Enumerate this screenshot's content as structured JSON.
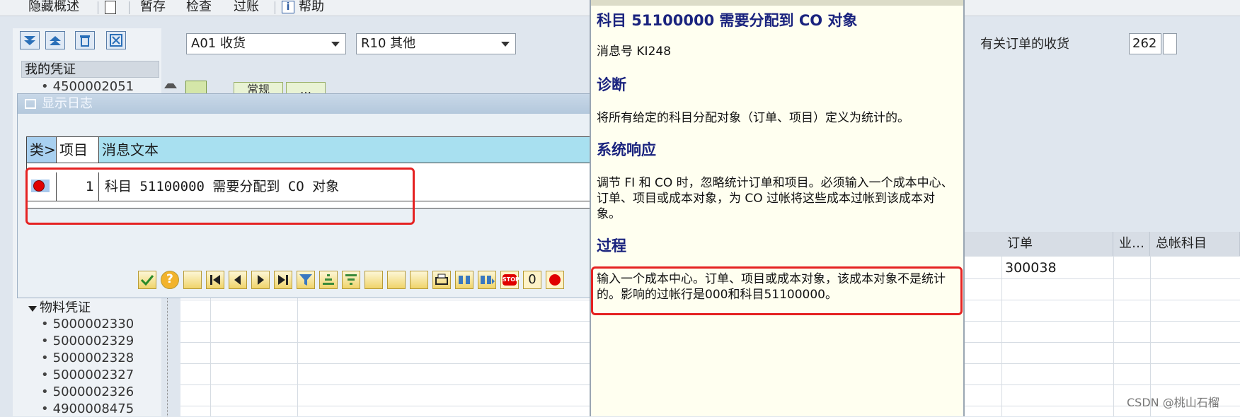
{
  "menubar": {
    "items": [
      "隐藏概述",
      "暂存",
      "检查",
      "过账",
      "帮助"
    ]
  },
  "header": {
    "action_value": "A01 收货",
    "ref_value": "R10 其他",
    "order_receipt_label": "有关订单的收货",
    "receipt_number": "262"
  },
  "tabs": [
    "常规",
    "…"
  ],
  "nav": {
    "mydoc_title": "我的凭证",
    "top_number": "4500002051",
    "matdoc_title": "物料凭证",
    "numbers": [
      "5000002330",
      "5000002329",
      "5000002328",
      "5000002327",
      "5000002326",
      "4900008475"
    ]
  },
  "log_dialog": {
    "title": "显示日志",
    "columns": [
      "类>",
      "项目",
      "消息文本"
    ],
    "rows": [
      {
        "item": "1",
        "text": "科目 51100000 需要分配到 CO 对象"
      }
    ],
    "stop_count": "0"
  },
  "grid": {
    "columns": [
      "订单",
      "业…",
      "总帐科目"
    ],
    "order_value": "300038"
  },
  "help": {
    "title": "科目 51100000 需要分配到 CO 对象",
    "msg_no": "消息号 KI248",
    "diag_title": "诊断",
    "diag_text": "将所有给定的科目分配对象（订单、项目）定义为统计的。",
    "resp_title": "系统响应",
    "resp_text": "调节 FI 和 CO 时，忽略统计订单和项目。必须输入一个成本中心、订单、项目或成本对象，为 CO 过帐将这些成本过帐到该成本对象。",
    "proc_title": "过程",
    "proc_text": "输入一个成本中心。订单、项目或成本对象，该成本对象不是统计的。影响的过帐行是000和科目51100000。"
  },
  "watermark": "CSDN @桃山石榴",
  "colors": {
    "highlight_box": "#e52222",
    "help_heading": "#1a237e",
    "stop_red": "#e00000"
  }
}
